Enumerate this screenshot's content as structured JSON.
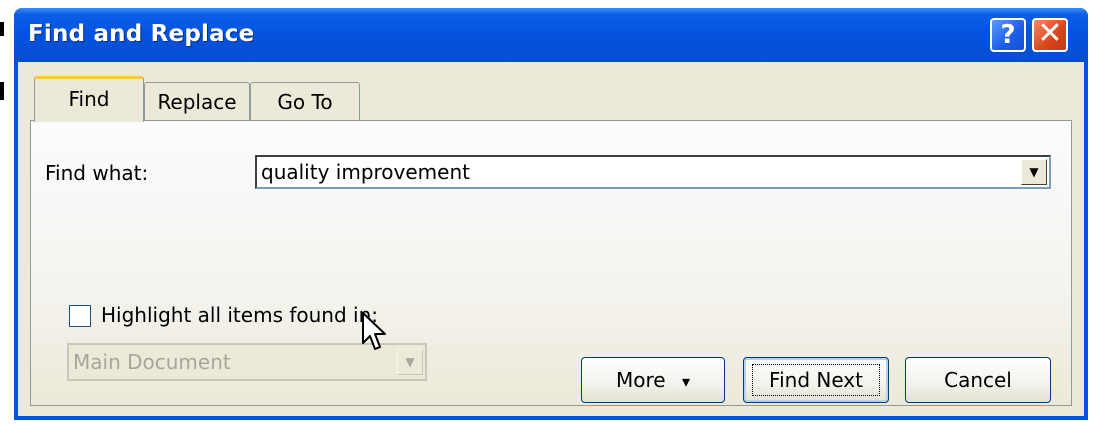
{
  "dialog": {
    "title": "Find and Replace",
    "help_button": "?",
    "close_button": "✕"
  },
  "tabs": [
    {
      "label": "Find",
      "mnemonic": "d",
      "active": true
    },
    {
      "label": "Replace",
      "mnemonic": "p",
      "active": false
    },
    {
      "label": "Go To",
      "mnemonic": "G",
      "active": false
    }
  ],
  "find": {
    "label": "Find what:",
    "value": "quality improvement"
  },
  "highlight": {
    "label": "Highlight all items found in:",
    "checked": false,
    "scope_value": "Main Document",
    "scope_enabled": false
  },
  "buttons": {
    "more": "More",
    "more_arrow": "▾",
    "find_next": "Find Next",
    "cancel": "Cancel"
  },
  "colors": {
    "titlebar": "#0554e0",
    "dialog_bg": "#ece9d8",
    "close_button": "#d9441a",
    "tab_highlight": "#ffc73c"
  },
  "icons": {
    "combo_arrow": "chevron-down-icon",
    "cursor": "mouse-pointer-icon"
  }
}
